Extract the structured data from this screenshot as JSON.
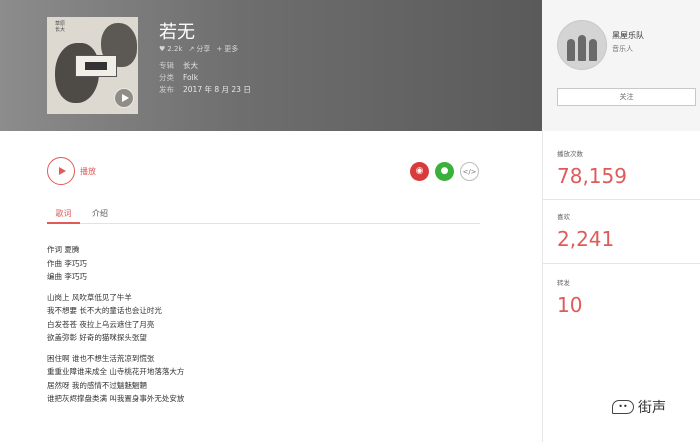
{
  "song": {
    "title": "若无",
    "likes": "2.2k",
    "share_label": "分享",
    "more_label": "更多",
    "meta": [
      {
        "key": "专辑",
        "value": "长大"
      },
      {
        "key": "分类",
        "value": "Folk"
      },
      {
        "key": "发布",
        "value": "2017 年 8 月 23 日"
      }
    ],
    "cover_text": "草原\n长大"
  },
  "artist": {
    "name": "黑屋乐队",
    "role": "音乐人",
    "follow_label": "关注"
  },
  "player": {
    "play_label": "播放"
  },
  "share_icons": [
    "weibo-icon",
    "wechat-icon",
    "embed-icon"
  ],
  "tabs": {
    "lyrics": "歌词",
    "intro": "介绍"
  },
  "lyrics": [
    [
      "作词 夏腾",
      "作曲 李巧巧",
      "编曲 李巧巧"
    ],
    [
      "山岗上 风吹草低见了牛羊",
      "我不想要 长不大的童话也会让时光",
      "白发苍苍 夜拉上乌云遮住了月亮",
      "欲盖弥彰 好奇的猫咪探头张望"
    ],
    [
      "困住啊 谁也不想生活荒凉到慌张",
      "重重业障谁来成全 山寺桃花开地落落大方",
      "居然呀 我的感情不过魑魅魍魉",
      "谁把灰烬撑盘类满 叫我置身事外无处安放"
    ]
  ],
  "stats": {
    "plays_label": "播放次数",
    "plays": "78,159",
    "likes_label": "喜欢",
    "likes": "2,241",
    "shares_label": "转发",
    "shares": "10"
  },
  "watermark": "街声"
}
